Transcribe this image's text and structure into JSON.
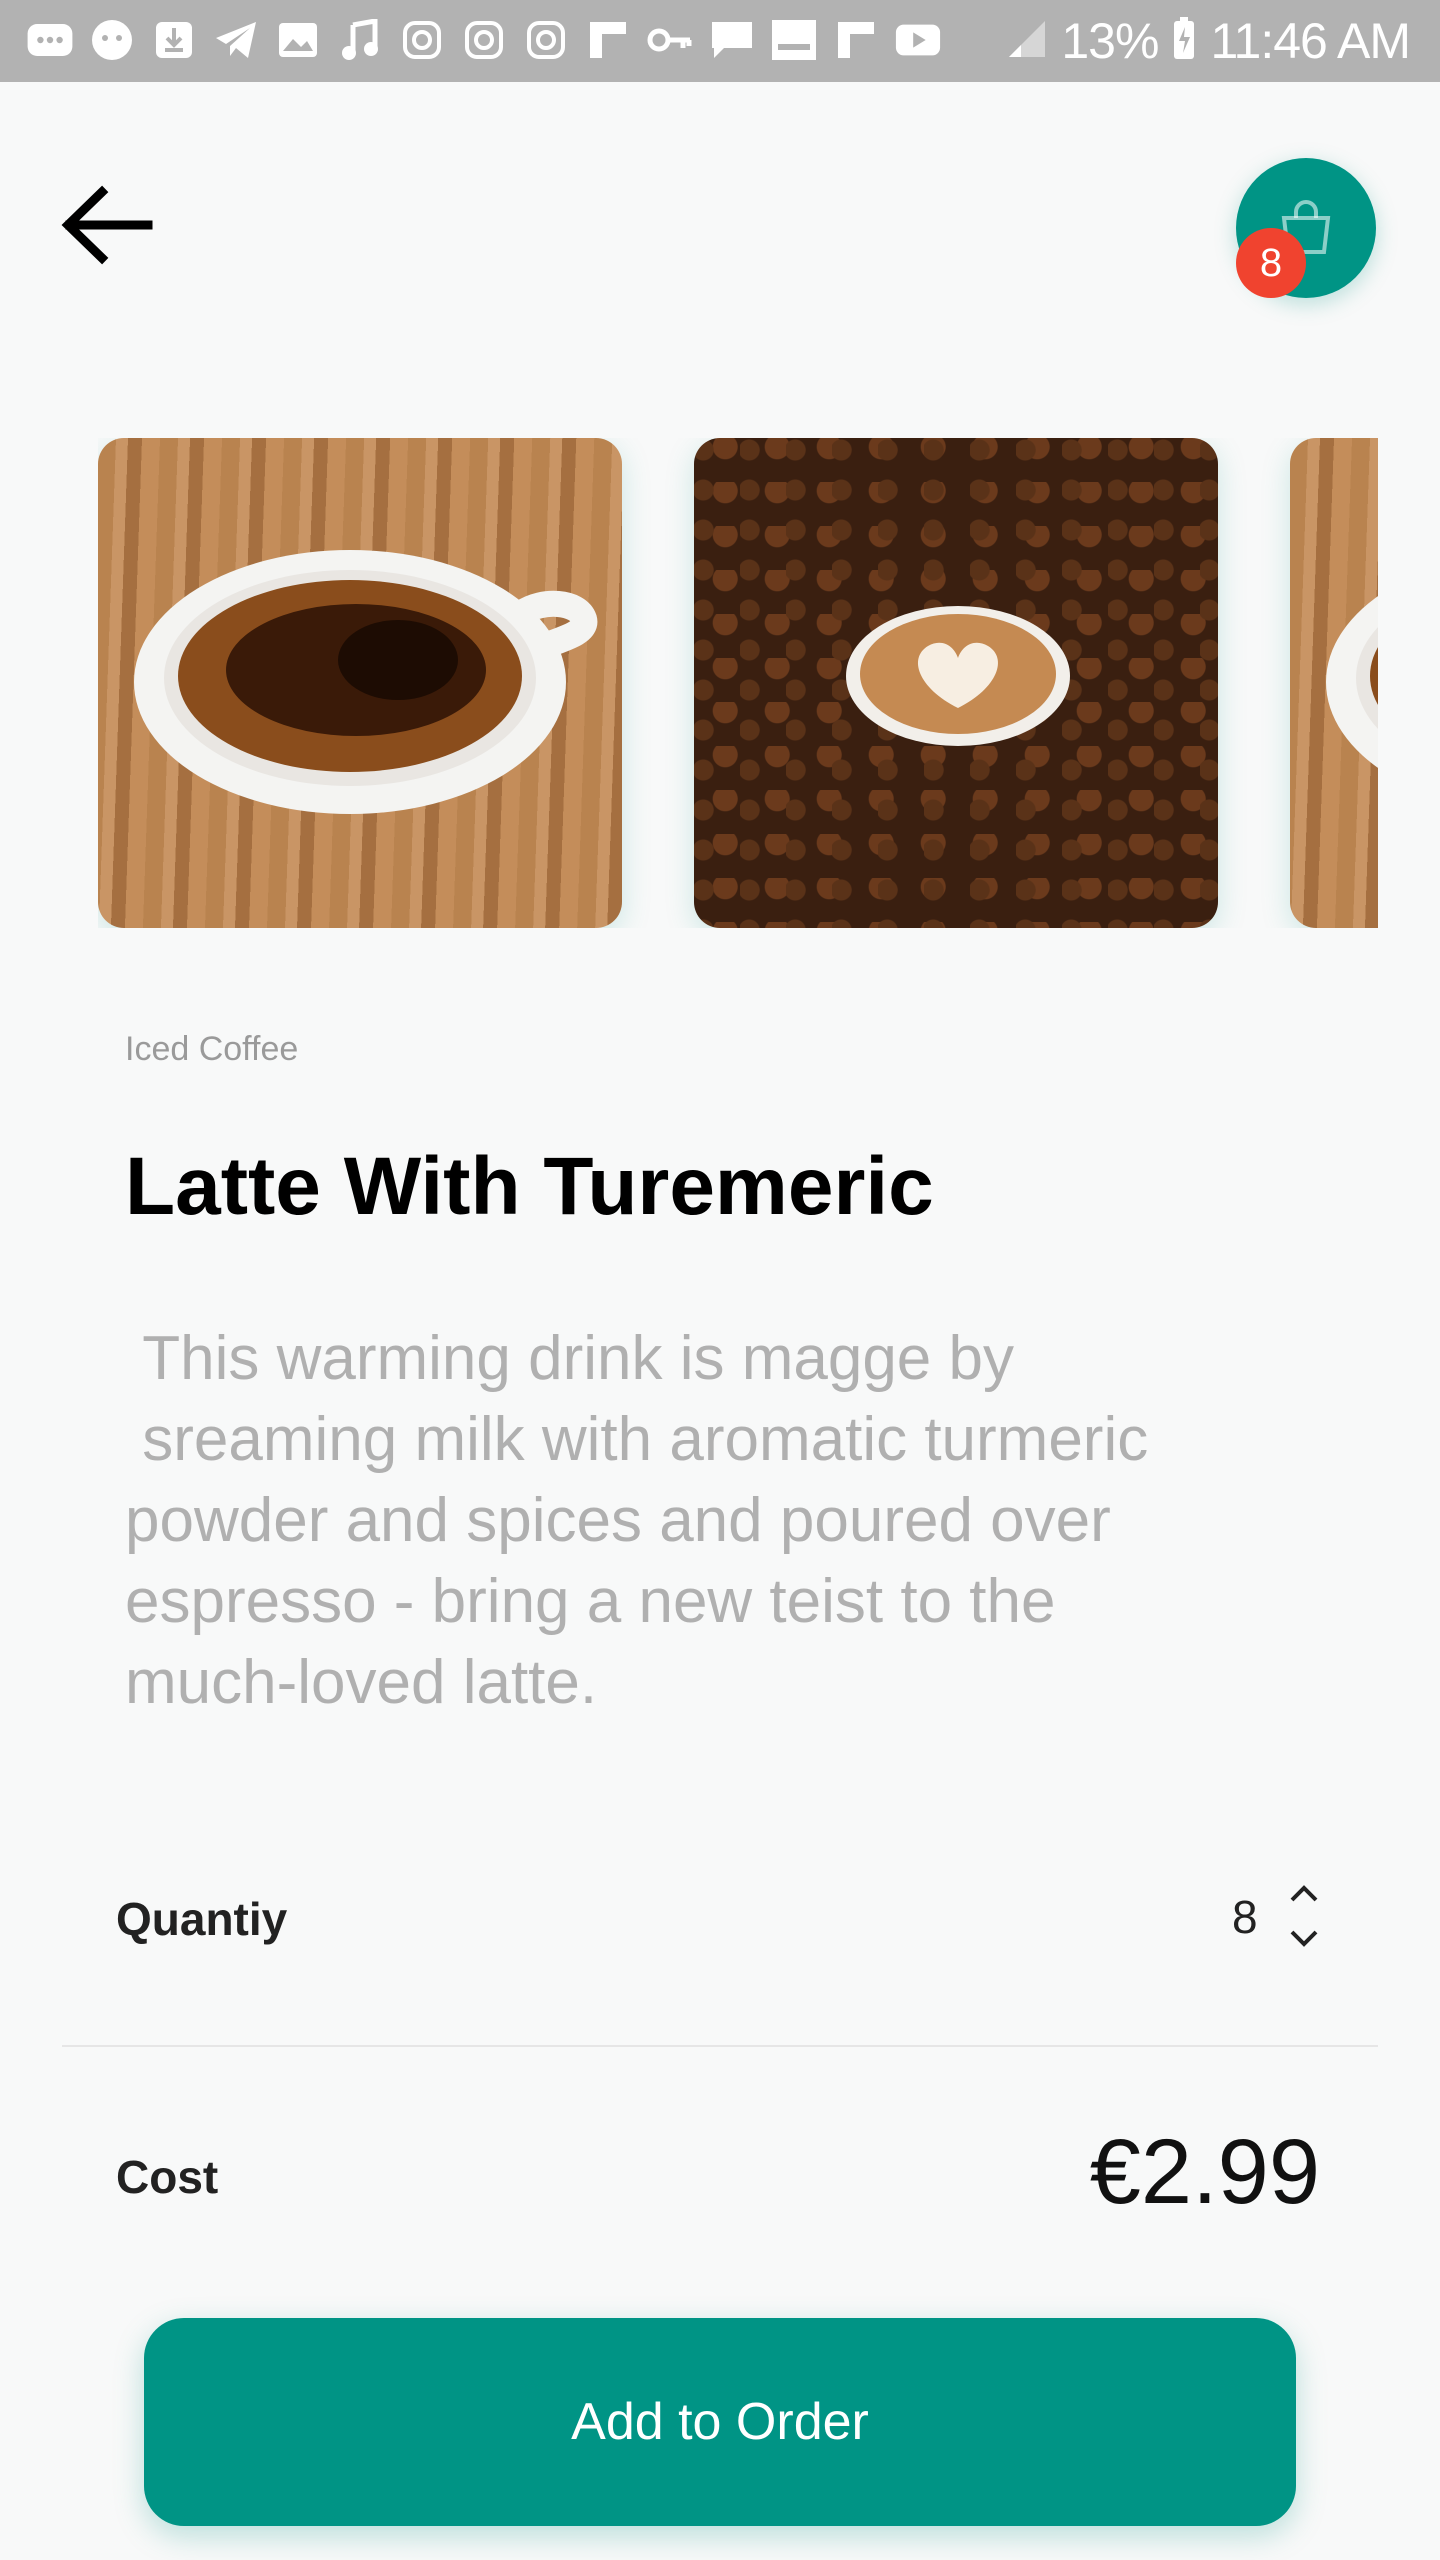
{
  "status_bar": {
    "battery": "13%",
    "time": "11:46 AM"
  },
  "header": {
    "cart_count": "8"
  },
  "product": {
    "category": "Iced Coffee",
    "name": "Latte With Turemeric",
    "description": " This warming drink is magge by\n sreaming milk with aromatic turmeric\npowder and spices and poured over\nespresso - bring a new teist to the\nmuch-loved latte."
  },
  "quantity": {
    "label": "Quantiy",
    "value": "8"
  },
  "cost": {
    "label": "Cost",
    "value": "€2.99"
  },
  "actions": {
    "add_label": "Add to Order"
  },
  "colors": {
    "accent": "#009485",
    "badge": "#f0432f",
    "background": "#f8f9f9"
  }
}
